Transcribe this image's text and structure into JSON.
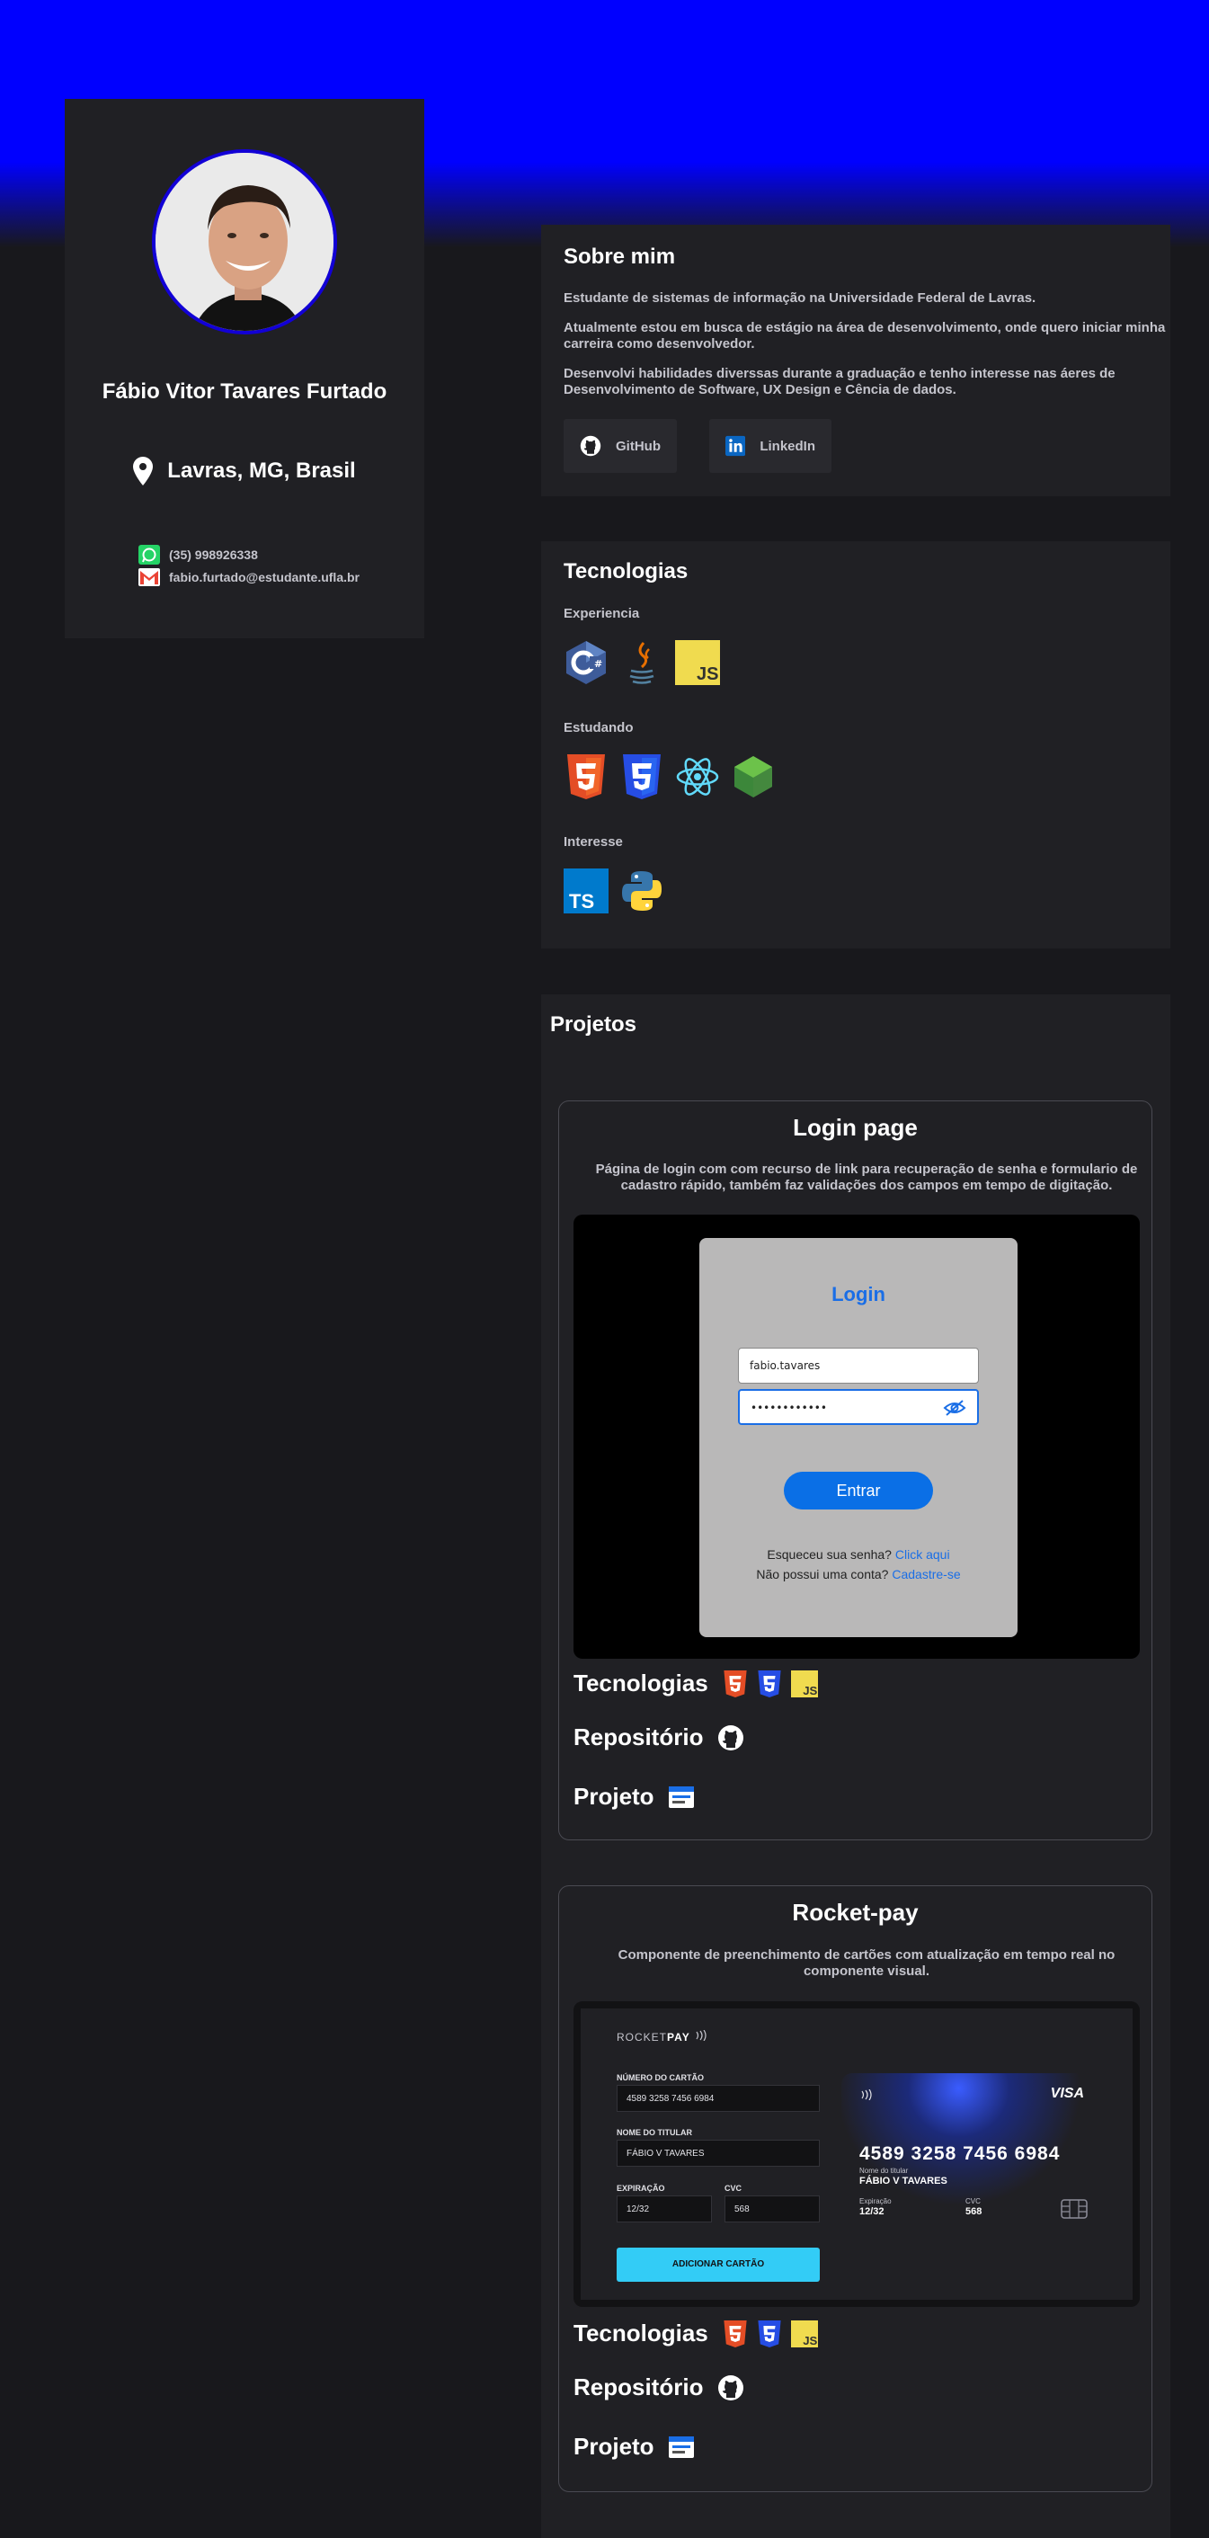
{
  "profile": {
    "name": "Fábio Vitor Tavares Furtado",
    "location": "Lavras, MG, Brasil",
    "phone": "(35) 998926338",
    "email": "fabio.furtado@estudante.ufla.br"
  },
  "about": {
    "title": "Sobre mim",
    "paragraphs": [
      "Estudante de sistemas de informação na Universidade Federal de Lavras.",
      "Atualmente estou em busca de estágio na área de desenvolvimento, onde quero iniciar minha carreira como desenvolvedor.",
      "Desenvolvi habilidades diverssas durante a graduação e tenho interesse nas áeres de Desenvolvimento de Software, UX Design e Cência de dados."
    ],
    "github_label": "GitHub",
    "linkedin_label": "LinkedIn"
  },
  "technologies": {
    "title": "Tecnologias",
    "experience_label": "Experiencia",
    "experience": [
      "c-sharp-icon",
      "java-icon",
      "javascript-icon"
    ],
    "studying_label": "Estudando",
    "studying": [
      "html5-icon",
      "css3-icon",
      "react-icon",
      "nodejs-icon"
    ],
    "interest_label": "Interesse",
    "interest": [
      "typescript-icon",
      "python-icon"
    ]
  },
  "projects": {
    "title": "Projetos",
    "items": [
      {
        "title": "Login page",
        "description": "Página de login com com recurso de link para recuperação de senha e formulario de cadastro rápido, também faz validações dos campos em tempo de digitação.",
        "tech_label": "Tecnologias",
        "repo_label": "Repositório",
        "project_label": "Projeto",
        "preview": {
          "title": "Login",
          "username": "fabio.tavares",
          "password": "••••••••••••",
          "button": "Entrar",
          "forgot_text": "Esqueceu sua senha?",
          "forgot_link": "Click aqui",
          "signup_text": "Não possui uma conta?",
          "signup_link": "Cadastre-se"
        }
      },
      {
        "title": "Rocket-pay",
        "description": "Componente de preenchimento de cartões com atualização em tempo real no componente visual.",
        "tech_label": "Tecnologias",
        "repo_label": "Repositório",
        "project_label": "Projeto",
        "preview": {
          "logo_light": "ROCKET",
          "logo_bold": "PAY",
          "card_number_label": "NÚMERO DO CARTÃO",
          "card_number": "4589 3258 7456 6984",
          "holder_label": "NOME DO TITULAR",
          "holder": "FÁBIO V TAVARES",
          "expiry_label": "EXPIRAÇÃO",
          "expiry": "12/32",
          "cvc_label": "CVC",
          "cvc": "568",
          "button": "ADICIONAR CARTÃO",
          "brand": "VISA",
          "card_holder_label": "Nome do titular",
          "card_expiry_label": "Expiração",
          "card_cvc_label": "CVC"
        }
      }
    ]
  },
  "colors": {
    "accent_blue": "#0000ff",
    "panel": "#202024",
    "background": "#18181c",
    "link": "#1a6ee6",
    "rocketpay_button": "#33ccf6"
  }
}
